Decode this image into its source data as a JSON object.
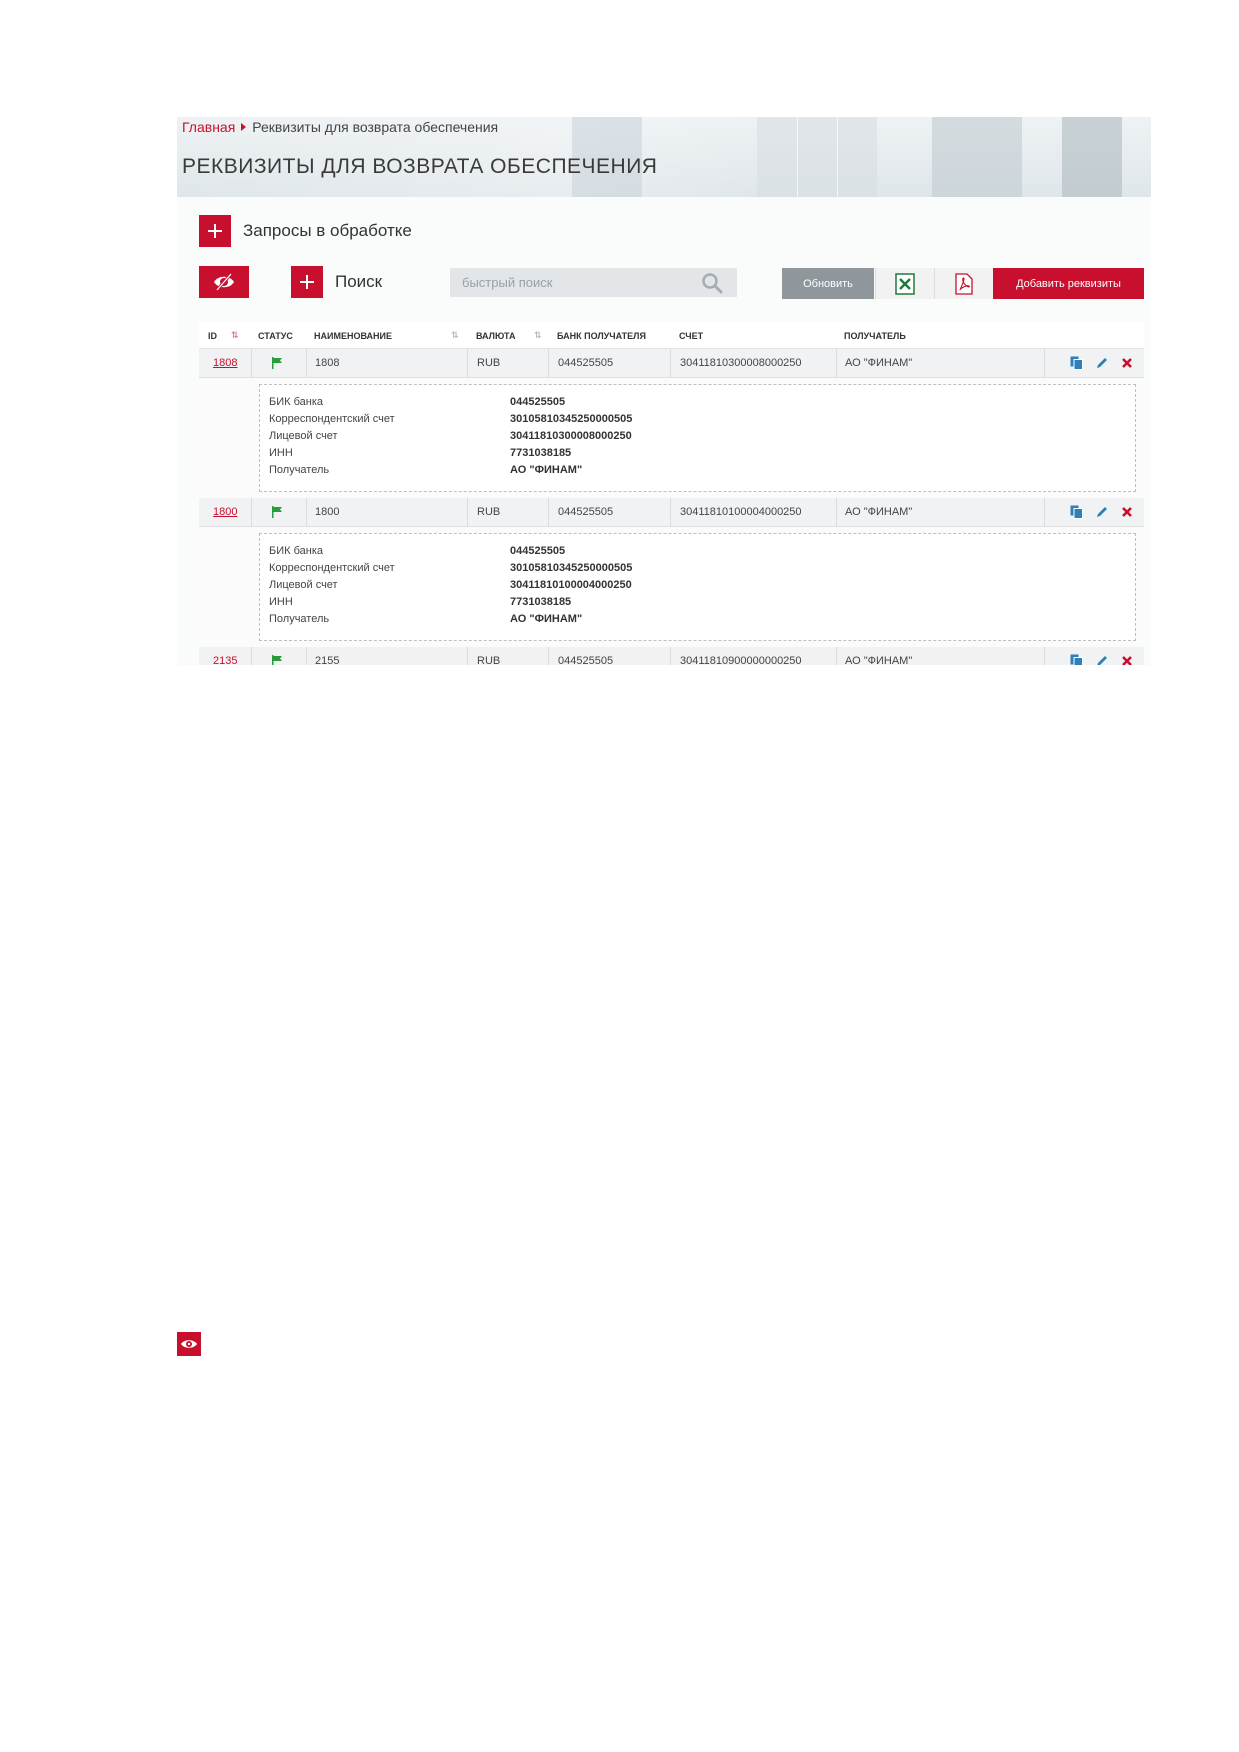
{
  "breadcrumb": {
    "home": "Главная",
    "current": "Реквизиты для возврата обеспечения"
  },
  "page_title": "РЕКВИЗИТЫ ДЛЯ ВОЗВРАТА ОБЕСПЕЧЕНИЯ",
  "sections": {
    "requests": "Запросы в обработке",
    "search": "Поиск"
  },
  "search": {
    "placeholder": "быстрый поиск"
  },
  "toolbar": {
    "refresh_label": "Обновить",
    "excel_icon": "excel-icon",
    "pdf_icon": "pdf-icon",
    "add_label": "Добавить реквизиты"
  },
  "colors": {
    "accent": "#c8102e",
    "flag": "#2a9d3a",
    "action_icon": "#2f7fb8",
    "delete": "#c8102e"
  },
  "table": {
    "headers": {
      "id": "ID",
      "status": "СТАТУС",
      "name": "НАИМЕНОВАНИЕ",
      "currency": "ВАЛЮТА",
      "bank": "БАНК ПОЛУЧАТЕЛЯ",
      "account": "СЧЕТ",
      "recipient": "ПОЛУЧАТЕЛЬ"
    },
    "rows": [
      {
        "id": "1808",
        "name": "1808",
        "currency": "RUB",
        "bank": "044525505",
        "account": "30411810300008000250",
        "recipient": "АО \"ФИНАМ\"",
        "details": {
          "labels": [
            "БИК банка",
            "Корреспондентский счет",
            "Лицевой счет",
            "ИНН",
            "Получатель"
          ],
          "values": [
            "044525505",
            "30105810345250000505",
            "30411810300008000250",
            "7731038185",
            "АО \"ФИНАМ\""
          ]
        }
      },
      {
        "id": "1800",
        "name": "1800",
        "currency": "RUB",
        "bank": "044525505",
        "account": "30411810100004000250",
        "recipient": "АО \"ФИНАМ\"",
        "details": {
          "labels": [
            "БИК банка",
            "Корреспондентский счет",
            "Лицевой счет",
            "ИНН",
            "Получатель"
          ],
          "values": [
            "044525505",
            "30105810345250000505",
            "30411810100004000250",
            "7731038185",
            "АО \"ФИНАМ\""
          ]
        }
      },
      {
        "id": "2135",
        "name": "2155",
        "currency": "RUB",
        "bank": "044525505",
        "account": "30411810900000000250",
        "recipient": "АО \"ФИНАМ\""
      }
    ]
  }
}
